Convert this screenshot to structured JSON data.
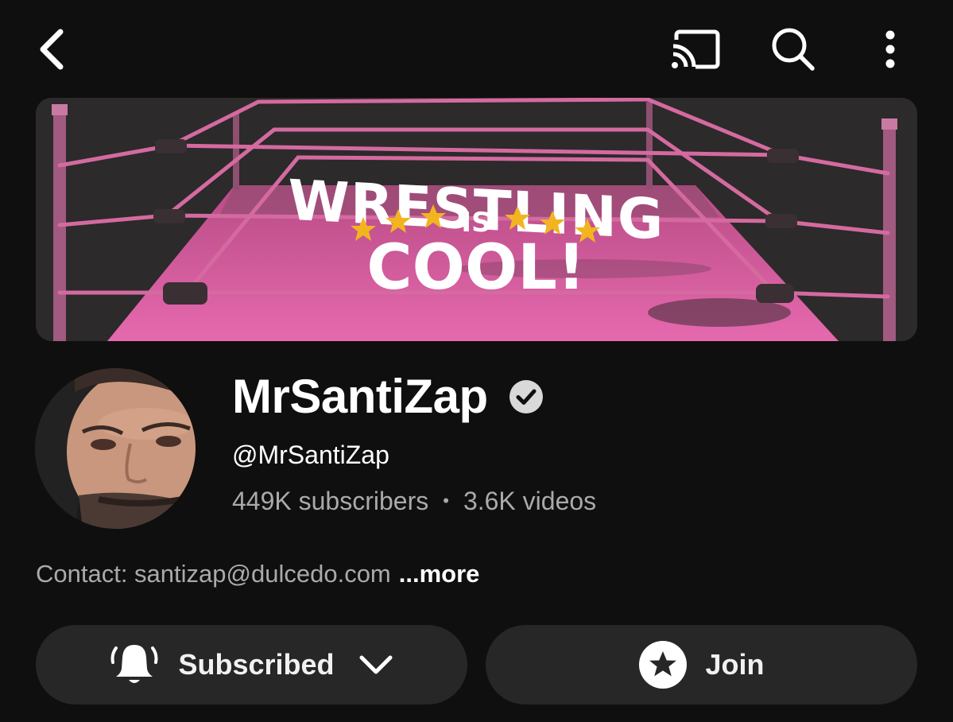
{
  "topbar": {
    "back_icon": "chevron-left-icon",
    "cast_icon": "cast-icon",
    "search_icon": "search-icon",
    "more_icon": "more-vertical-icon"
  },
  "banner": {
    "line1": "WRESTLING",
    "line2": "IS",
    "line3": "COOL!",
    "colors": {
      "ring_pink": "#e85fa8",
      "star": "#f2b51f",
      "text": "#ffffff"
    }
  },
  "channel": {
    "name": "MrSantiZap",
    "handle": "@MrSantiZap",
    "subscribers": "449K subscribers",
    "separator": "•",
    "videos": "3.6K videos",
    "verified_icon": "verified-check-icon"
  },
  "description": {
    "text": "Contact: santizap@dulcedo.com",
    "more": "...more"
  },
  "actions": {
    "subscribe_label": "Subscribed",
    "join_label": "Join"
  }
}
